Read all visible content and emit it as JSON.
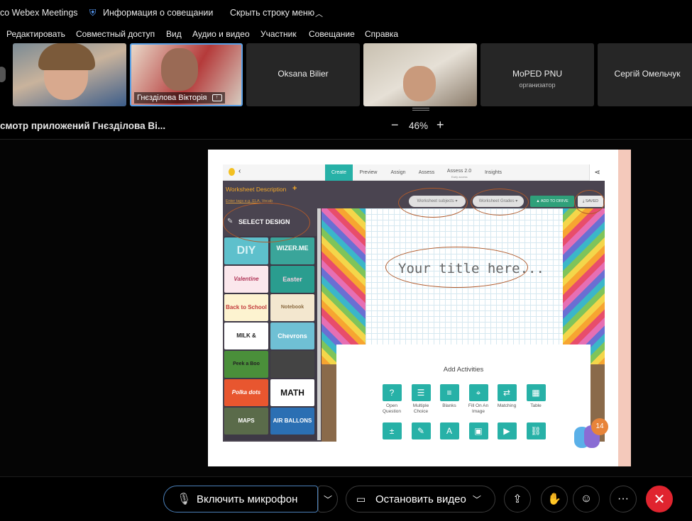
{
  "titlebar": {
    "app_name": "co Webex Meetings",
    "meeting_info": "Информация о совещании",
    "hide_menu": "Скрыть строку меню"
  },
  "menu": [
    "Редактировать",
    "Совместный доступ",
    "Вид",
    "Аудио и видео",
    "Участник",
    "Совещание",
    "Справка"
  ],
  "participants": [
    {
      "name": ""
    },
    {
      "name": "Гнєзділова Вікторія"
    },
    {
      "name": "Oksana Bilier"
    },
    {
      "name": ""
    },
    {
      "name": "MoPED PNU",
      "role": "организатор"
    },
    {
      "name": "Сергій Омельчук"
    }
  ],
  "sharebar": {
    "title": "смотр приложений Гнєзділова Ві...",
    "zoom": "46%"
  },
  "app": {
    "tabs": [
      "Create",
      "Preview",
      "Assign",
      "Assess",
      "Assess 2.0",
      "Insights"
    ],
    "tab_sub": "Early access",
    "worksheet_description": "Worksheet Description",
    "tags_hint": "Enter tags e.g. ELA, Vocab",
    "subjects": "Worksheet subjects ▾",
    "grades": "Worksheet Grades ▾",
    "add_to_drive": "ADD TO DRIVE",
    "saved": "SAVED",
    "select_design": "SELECT DESIGN",
    "title_placeholder": "Your title here...",
    "add_activities": "Add Activities",
    "badge": "14",
    "designs": [
      "DIY",
      "WIZER.ME",
      "Valentine",
      "Easter",
      "Back to School",
      "Notebook",
      "MILK & COOKIES",
      "Chevrons",
      "Peek a Boo",
      "",
      "Polka dots",
      "MATH",
      "MAPS",
      "AIR BALLONS"
    ],
    "activities": [
      {
        "label": "Open Question",
        "icon": "?"
      },
      {
        "label": "Multiple Choice",
        "icon": "☰"
      },
      {
        "label": "Blanks",
        "icon": "≡"
      },
      {
        "label": "Fill On An Image",
        "icon": "⌖"
      },
      {
        "label": "Matching",
        "icon": "⇄"
      },
      {
        "label": "Table",
        "icon": "▦"
      }
    ]
  },
  "controls": {
    "mic": "Включить микрофон",
    "video": "Остановить видео"
  },
  "colors": {
    "accent": "#27b1a7",
    "end_call": "#e0242f",
    "annotation": "#b05a2b"
  }
}
